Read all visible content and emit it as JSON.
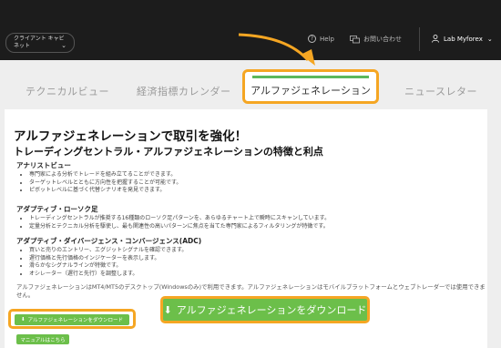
{
  "topbar": {
    "client_cabinet_label": "クライアント キャビネット",
    "help_label": "Help",
    "contact_label": "お問い合わせ",
    "user_name": "Lab Myforex"
  },
  "tabs": [
    {
      "label": "テクニカルビュー"
    },
    {
      "label": "経済指標カレンダー"
    },
    {
      "label": "アルファジェネレーション"
    },
    {
      "label": "ニュースレター"
    }
  ],
  "content": {
    "title": "アルファジェネレーションで取引を強化！",
    "subtitle": "トレーディングセントラル・アルファジェネレーションの特徴と利点",
    "sections": [
      {
        "heading": "アナリストビュー",
        "items": [
          "専門家による分析でトレードを組み立てることができます。",
          "ターゲットレベルとともに方向性を把握することが可能です。",
          "ピボットレベルに基づく代替シナリオを発見できます。"
        ]
      },
      {
        "heading": "アダプティブ・ローソク足",
        "items": [
          "トレーディングセントラルが推奨する16種類のローソク足パターンを、あらゆるチャート上で瞬時にスキャンしています。",
          "定量分析とテクニカル分析を駆使し、最も関連性の高いパターンに焦点を当てた専門家によるフィルタリングが特徴です。"
        ]
      },
      {
        "heading": "アダプティブ・ダイバージェンス・コンバージェンス(ADC)",
        "items": [
          "買いと売りのエントリー、エグジットシグナルを確認できます。",
          "遅行価格と先行価格のインジケーターを表示します。",
          "滑らかなシグナルラインが特徴です。",
          "オシレーター（遅行と先行）を調整します。"
        ]
      }
    ],
    "note": "アルファジェネレーションはMT4/MT5のデスクトップ(Windowsのみ)で利用できます。アルファジェネレーションはモバイルプラットフォームとウェブトレーダーでは使用できません。",
    "download_label": "アルファジェネレーションをダウンロード",
    "second_button_label": "マニュアルはこちら"
  },
  "colors": {
    "accent_orange": "#f5a623",
    "button_green": "#6cbf4a",
    "topbar_bg": "#1c1c1c"
  }
}
